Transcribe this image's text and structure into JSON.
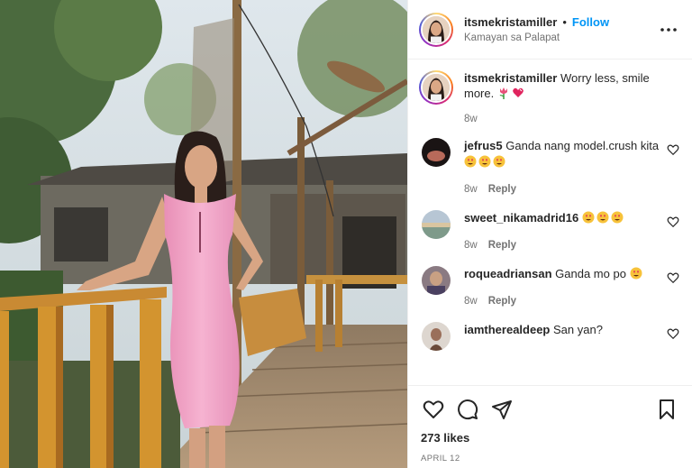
{
  "header": {
    "username": "itsmekristamiller",
    "separator": "•",
    "follow_label": "Follow",
    "location": "Kamayan sa Palapat"
  },
  "caption": {
    "username": "itsmekristamiller",
    "text": "Worry less, smile more.",
    "emojis": [
      "tulip-emoji",
      "heart-emoji"
    ],
    "time": "8w"
  },
  "comments": [
    {
      "username": "jefrus5",
      "text": "Ganda nang model.crush kita",
      "emojis": [
        "heart-eyes-emoji",
        "heart-eyes-emoji",
        "heart-eyes-emoji"
      ],
      "time": "8w",
      "reply": "Reply"
    },
    {
      "username": "sweet_nikamadrid16",
      "text": "",
      "emojis": [
        "heart-eyes-emoji",
        "heart-eyes-emoji",
        "heart-eyes-emoji"
      ],
      "time": "8w",
      "reply": "Reply"
    },
    {
      "username": "roqueadriansan",
      "text": "Ganda mo po",
      "emojis": [
        "heart-eyes-emoji"
      ],
      "time": "8w",
      "reply": "Reply"
    },
    {
      "username": "iamtherealdeep",
      "text": "San yan?",
      "emojis": [],
      "time": "",
      "reply": ""
    }
  ],
  "actions": {
    "likes": "273 likes",
    "date": "APRIL 12"
  },
  "colors": {
    "follow_blue": "#0095f6",
    "muted": "#737373",
    "dress_pink": "#f2a5c8",
    "heart_red": "#ed4956"
  }
}
